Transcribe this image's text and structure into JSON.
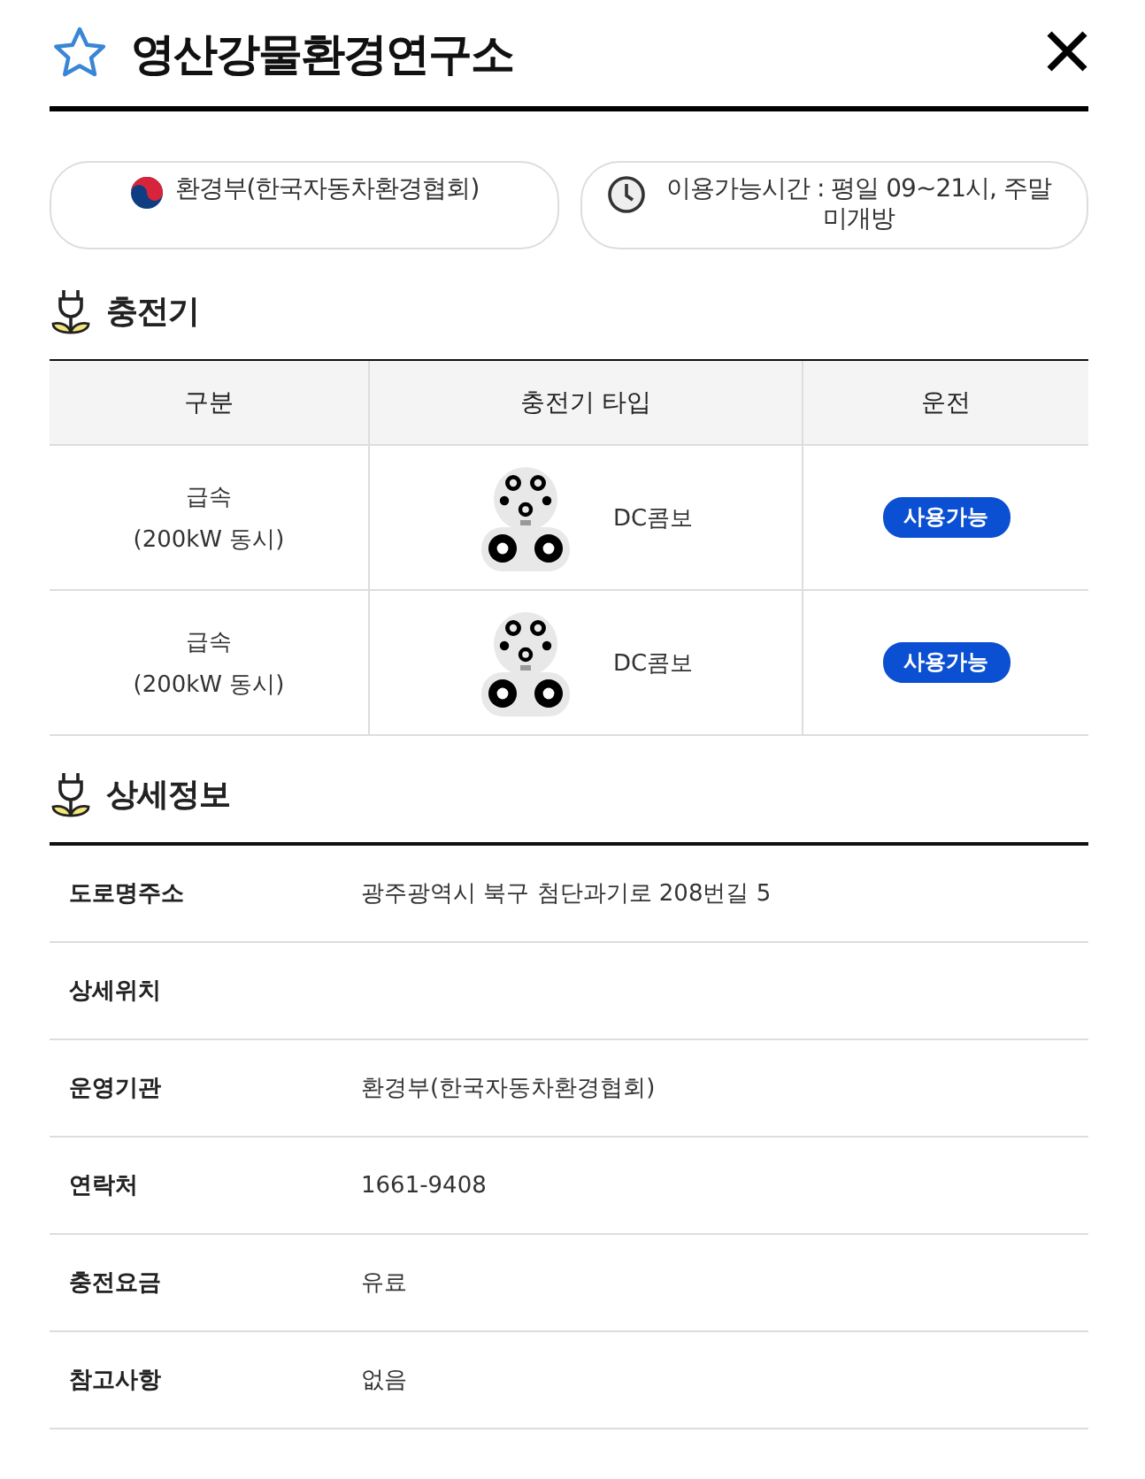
{
  "title": "영산강물환경연구소",
  "favorite": false,
  "info": [
    {
      "kind": "operator",
      "text": "환경부(한국자동차환경협회)"
    },
    {
      "kind": "hours",
      "text": "이용가능시간 : 평일 09~21시, 주말 미개방"
    }
  ],
  "charger_section": {
    "title": "충전기",
    "columns": [
      "구분",
      "충전기 타입",
      "운전"
    ],
    "rows": [
      {
        "speed": "급속",
        "power": "(200kW 동시)",
        "type": "DC콤보",
        "status": "사용가능"
      },
      {
        "speed": "급속",
        "power": "(200kW 동시)",
        "type": "DC콤보",
        "status": "사용가능"
      }
    ]
  },
  "detail_section": {
    "title": "상세정보",
    "rows": [
      {
        "label": "도로명주소",
        "value": "광주광역시 북구 첨단과기로 208번길 5"
      },
      {
        "label": "상세위치"
      },
      {
        "label": "운영기관",
        "value": "환경부(한국자동차환경협회)"
      },
      {
        "label": "연락처",
        "value": "1661-9408"
      },
      {
        "label": "충전요금",
        "value": "유료"
      },
      {
        "label": "참고사항",
        "value": "없음"
      }
    ]
  }
}
